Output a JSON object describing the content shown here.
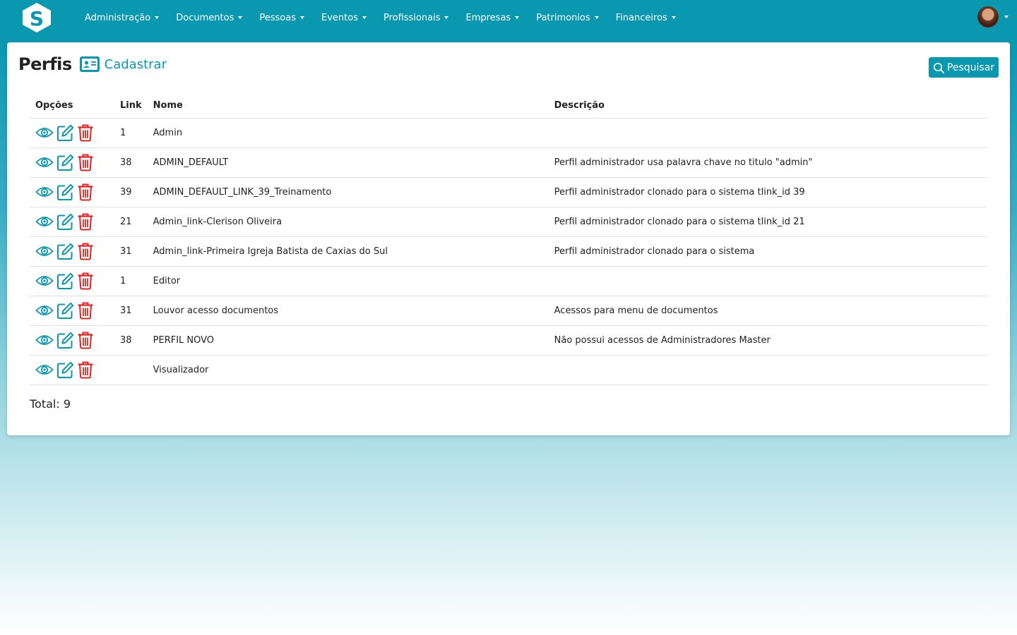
{
  "navbar": {
    "logo_letter": "S",
    "menu": [
      {
        "label": "Administração"
      },
      {
        "label": "Documentos"
      },
      {
        "label": "Pessoas"
      },
      {
        "label": "Eventos"
      },
      {
        "label": "Profissionais"
      },
      {
        "label": "Empresas"
      },
      {
        "label": "Patrimonios"
      },
      {
        "label": "Financeiros"
      }
    ]
  },
  "page": {
    "title": "Perfis",
    "create_label": "Cadastrar",
    "search_label": "Pesquisar"
  },
  "table": {
    "headers": {
      "options": "Opções",
      "link": "Link",
      "name": "Nome",
      "description": "Descrição"
    },
    "rows": [
      {
        "link": "1",
        "name": "Admin",
        "description": ""
      },
      {
        "link": "38",
        "name": "ADMIN_DEFAULT",
        "description": "Perfil administrador usa palavra chave no titulo \"admin\""
      },
      {
        "link": "39",
        "name": "ADMIN_DEFAULT_LINK_39_Treinamento",
        "description": "Perfil administrador clonado para o sistema tlink_id 39"
      },
      {
        "link": "21",
        "name": "Admin_link-Clerison Oliveira",
        "description": "Perfil administrador clonado para o sistema tlink_id 21"
      },
      {
        "link": "31",
        "name": "Admin_link-Primeira Igreja Batista de Caxias do Sul",
        "description": "Perfil administrador clonado para o sistema"
      },
      {
        "link": "1",
        "name": "Editor",
        "description": ""
      },
      {
        "link": "31",
        "name": "Louvor acesso documentos",
        "description": "Acessos para menu de documentos"
      },
      {
        "link": "38",
        "name": "PERFIL NOVO",
        "description": "Não possui acessos de Administradores Master"
      },
      {
        "link": "",
        "name": "Visualizador",
        "description": ""
      }
    ]
  },
  "footer": {
    "total_label": "Total: 9"
  },
  "icons": {
    "view": "eye-icon",
    "edit": "edit-icon",
    "delete": "trash-icon",
    "create": "id-card-icon",
    "search": "search-icon"
  },
  "colors": {
    "brand": "#0a97b0",
    "danger": "#e02424"
  }
}
